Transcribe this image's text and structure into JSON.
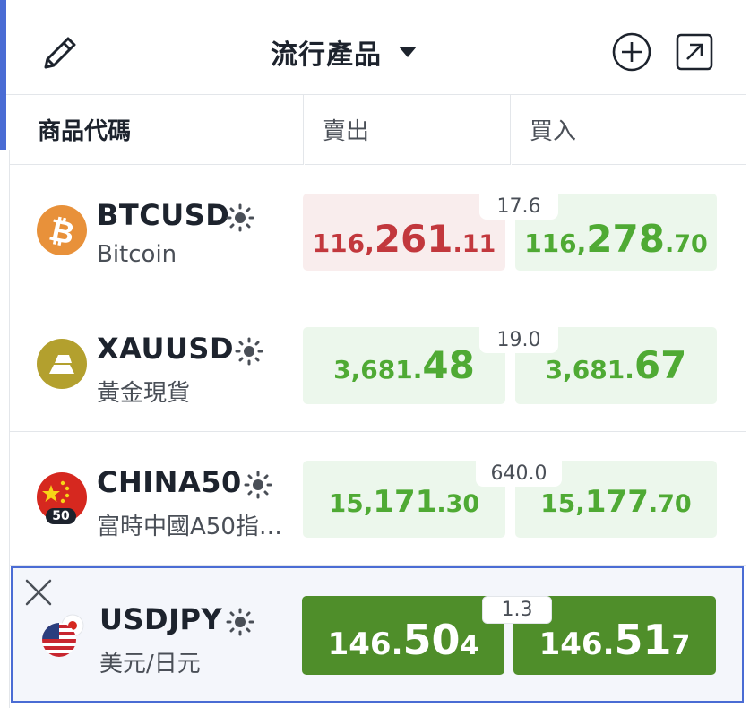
{
  "header": {
    "title": "流行產品",
    "edit_icon": "pencil-icon",
    "dropdown_icon": "caret-down-icon",
    "add_icon": "plus-circle-icon",
    "popout_icon": "arrow-up-right-square-icon"
  },
  "columns": {
    "symbol": "商品代碼",
    "sell": "賣出",
    "buy": "買入"
  },
  "rows": [
    {
      "code": "BTCUSD",
      "name": "Bitcoin",
      "icon": "bitcoin-icon",
      "spread": "17.6",
      "sell": {
        "pre": "116,",
        "big": "261",
        "post": ".11",
        "direction": "down"
      },
      "buy": {
        "pre": "116,",
        "big": "278",
        "post": ".70",
        "direction": "up"
      }
    },
    {
      "code": "XAUUSD",
      "name": "黃金現貨",
      "icon": "gold-bars-icon",
      "spread": "19.0",
      "sell": {
        "pre": "3,681.",
        "big": "48",
        "post": "",
        "direction": "up"
      },
      "buy": {
        "pre": "3,681.",
        "big": "67",
        "post": "",
        "direction": "up"
      }
    },
    {
      "code": "CHINA50",
      "name": "富時中國A50指…",
      "icon": "china-flag-icon",
      "badge": "50",
      "spread": "640.0",
      "sell": {
        "pre": "15,",
        "big": "171",
        "post": ".30",
        "direction": "up"
      },
      "buy": {
        "pre": "15,",
        "big": "177",
        "post": ".70",
        "direction": "up"
      }
    },
    {
      "code": "USDJPY",
      "name": "美元/日元",
      "icon": "us-japan-flag-icon",
      "spread": "1.3",
      "sell": {
        "pre": "146.",
        "big": "50",
        "post": "4",
        "direction": "solid"
      },
      "buy": {
        "pre": "146.",
        "big": "51",
        "post": "7",
        "direction": "solid"
      }
    }
  ],
  "colors": {
    "accent": "#4a6cd4",
    "down_text": "#c2383d",
    "down_bg": "#f9eded",
    "up_text": "#4faa34",
    "up_bg": "#ecf7ec",
    "solid_bg": "#4f8e2a"
  }
}
